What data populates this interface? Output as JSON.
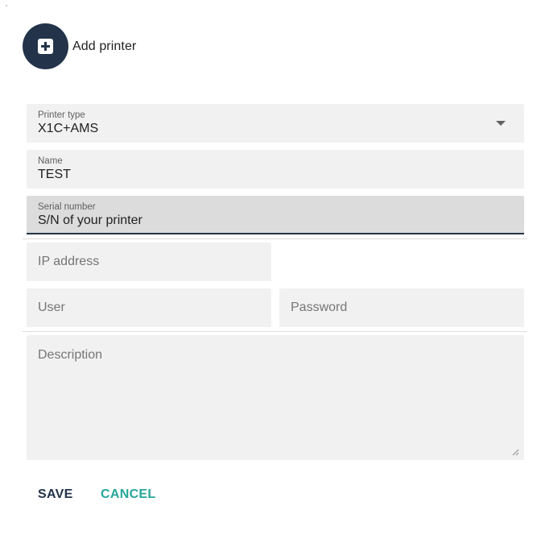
{
  "header": {
    "title": "Add printer",
    "icon": "add-box-icon",
    "accent_color": "#23334a"
  },
  "form": {
    "printer_type": {
      "label": "Printer type",
      "value": "X1C+AMS"
    },
    "name": {
      "label": "Name",
      "value": "TEST"
    },
    "serial_number": {
      "label": "Serial number",
      "placeholder": "S/N of your printer"
    },
    "ip_address": {
      "placeholder": "IP address"
    },
    "user": {
      "placeholder": "User"
    },
    "password": {
      "placeholder": "Password"
    },
    "description": {
      "placeholder": "Description"
    }
  },
  "actions": {
    "save_label": "SAVE",
    "cancel_label": "CANCEL",
    "cancel_color": "#26a69a"
  }
}
